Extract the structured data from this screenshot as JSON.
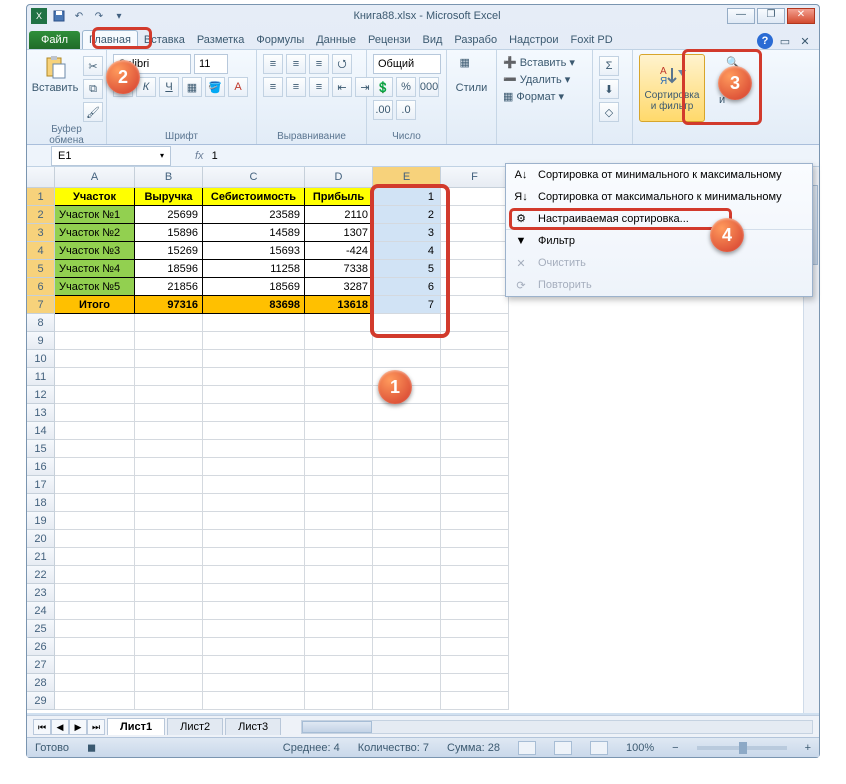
{
  "window": {
    "title": "Книга88.xlsx - Microsoft Excel",
    "min": "—",
    "max": "❐",
    "close": "✕"
  },
  "qat": {
    "save": "save-icon",
    "undo": "undo-icon",
    "redo": "redo-icon"
  },
  "tabs": {
    "file": "Файл",
    "items": [
      "Главная",
      "Вставка",
      "Разметка",
      "Формулы",
      "Данные",
      "Рецензи",
      "Вид",
      "Разрабо",
      "Надстрои",
      "Foxit PD"
    ],
    "active_index": 0
  },
  "ribbon": {
    "clipboard": {
      "label": "Буфер обмена",
      "paste": "Вставить"
    },
    "font": {
      "label": "Шрифт",
      "font_name": "Calibri",
      "font_size": "11",
      "bold": "Ж",
      "italic": "К",
      "underline": "Ч"
    },
    "align": {
      "label": "Выравнивание"
    },
    "number": {
      "label": "Число",
      "format": "Общий"
    },
    "styles": {
      "label": "Стили",
      "btn": "Стили"
    },
    "cells": {
      "insert": "Вставить",
      "delete": "Удалить",
      "format": "Формат"
    },
    "editing": {
      "sort_filter": "Сортировка и фильтр",
      "find": "Найти и"
    }
  },
  "formula_bar": {
    "name_box": "E1",
    "fx": "fx",
    "value": "1"
  },
  "grid": {
    "col_widths": {
      "A": 80,
      "B": 68,
      "C": 102,
      "D": 68,
      "E": 68,
      "F": 68
    },
    "columns": [
      "A",
      "B",
      "C",
      "D",
      "E",
      "F"
    ],
    "selected_col": "E",
    "headers": [
      "Участок",
      "Выручка",
      "Себистоимость",
      "Прибыль"
    ],
    "rows": [
      {
        "name": "Участок №1",
        "rev": "25699",
        "cost": "23589",
        "profit": "2110",
        "e": "2"
      },
      {
        "name": "Участок №2",
        "rev": "15896",
        "cost": "14589",
        "profit": "1307",
        "e": "3"
      },
      {
        "name": "Участок №3",
        "rev": "15269",
        "cost": "15693",
        "profit": "-424",
        "e": "4"
      },
      {
        "name": "Участок №4",
        "rev": "18596",
        "cost": "11258",
        "profit": "7338",
        "e": "5"
      },
      {
        "name": "Участок №5",
        "rev": "21856",
        "cost": "18569",
        "profit": "3287",
        "e": "6"
      }
    ],
    "e1": "1",
    "totals": {
      "label": "Итого",
      "rev": "97316",
      "cost": "83698",
      "profit": "13618",
      "e": "7"
    },
    "blank_rows": 22
  },
  "menu": {
    "items": [
      {
        "icon": "sort-asc-icon",
        "label": "Сортировка от минимального к максимальному",
        "disabled": false
      },
      {
        "icon": "sort-desc-icon",
        "label": "Сортировка от максимального к минимальному",
        "disabled": false
      },
      {
        "icon": "custom-sort-icon",
        "label": "Настраиваемая сортировка...",
        "disabled": false,
        "highlight": true,
        "sep": true
      },
      {
        "icon": "filter-icon",
        "label": "Фильтр",
        "disabled": false
      },
      {
        "icon": "clear-icon",
        "label": "Очистить",
        "disabled": true
      },
      {
        "icon": "reapply-icon",
        "label": "Повторить",
        "disabled": true
      }
    ]
  },
  "sheets": {
    "tabs": [
      "Лист1",
      "Лист2",
      "Лист3"
    ],
    "active": 0
  },
  "status": {
    "ready": "Готово",
    "avg_label": "Среднее:",
    "avg": "4",
    "count_label": "Количество:",
    "count": "7",
    "sum_label": "Сумма:",
    "sum": "28",
    "zoom": "100%",
    "zoom_minus": "−",
    "zoom_plus": "+"
  },
  "steps": {
    "s1": "1",
    "s2": "2",
    "s3": "3",
    "s4": "4"
  }
}
